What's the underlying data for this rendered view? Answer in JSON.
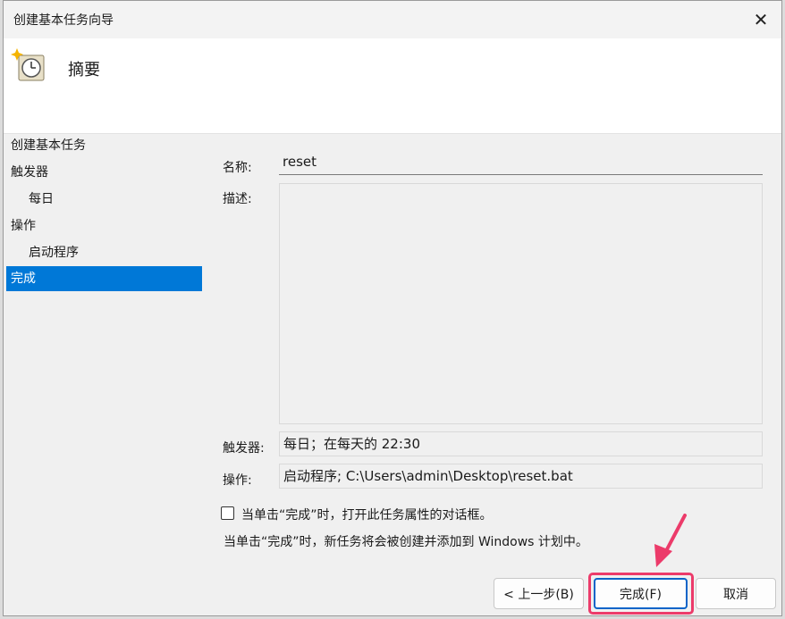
{
  "window": {
    "title": "创建基本任务向导"
  },
  "header": {
    "title": "摘要"
  },
  "sidebar": {
    "items": [
      {
        "label": "创建基本任务"
      },
      {
        "label": "触发器"
      },
      {
        "label": "每日"
      },
      {
        "label": "操作"
      },
      {
        "label": "启动程序"
      },
      {
        "label": "完成"
      }
    ]
  },
  "form": {
    "name_label": "名称:",
    "name_value": "reset",
    "desc_label": "描述:",
    "desc_value": "",
    "trigger_label": "触发器:",
    "trigger_value": "每日；在每天的 22:30",
    "action_label": "操作:",
    "action_value": "启动程序; C:\\Users\\admin\\Desktop\\reset.bat"
  },
  "checkbox": {
    "label": "当单击“完成”时，打开此任务属性的对话框。",
    "checked": false
  },
  "info_text": "当单击“完成”时，新任务将会被创建并添加到 Windows 计划中。",
  "buttons": {
    "back": "< 上一步(B)",
    "finish": "完成(F)",
    "cancel": "取消"
  },
  "icons": {
    "close": "close-icon",
    "header": "clock-sparkle-icon"
  },
  "colors": {
    "accent": "#0078d7",
    "highlight": "#ec3b6a"
  }
}
